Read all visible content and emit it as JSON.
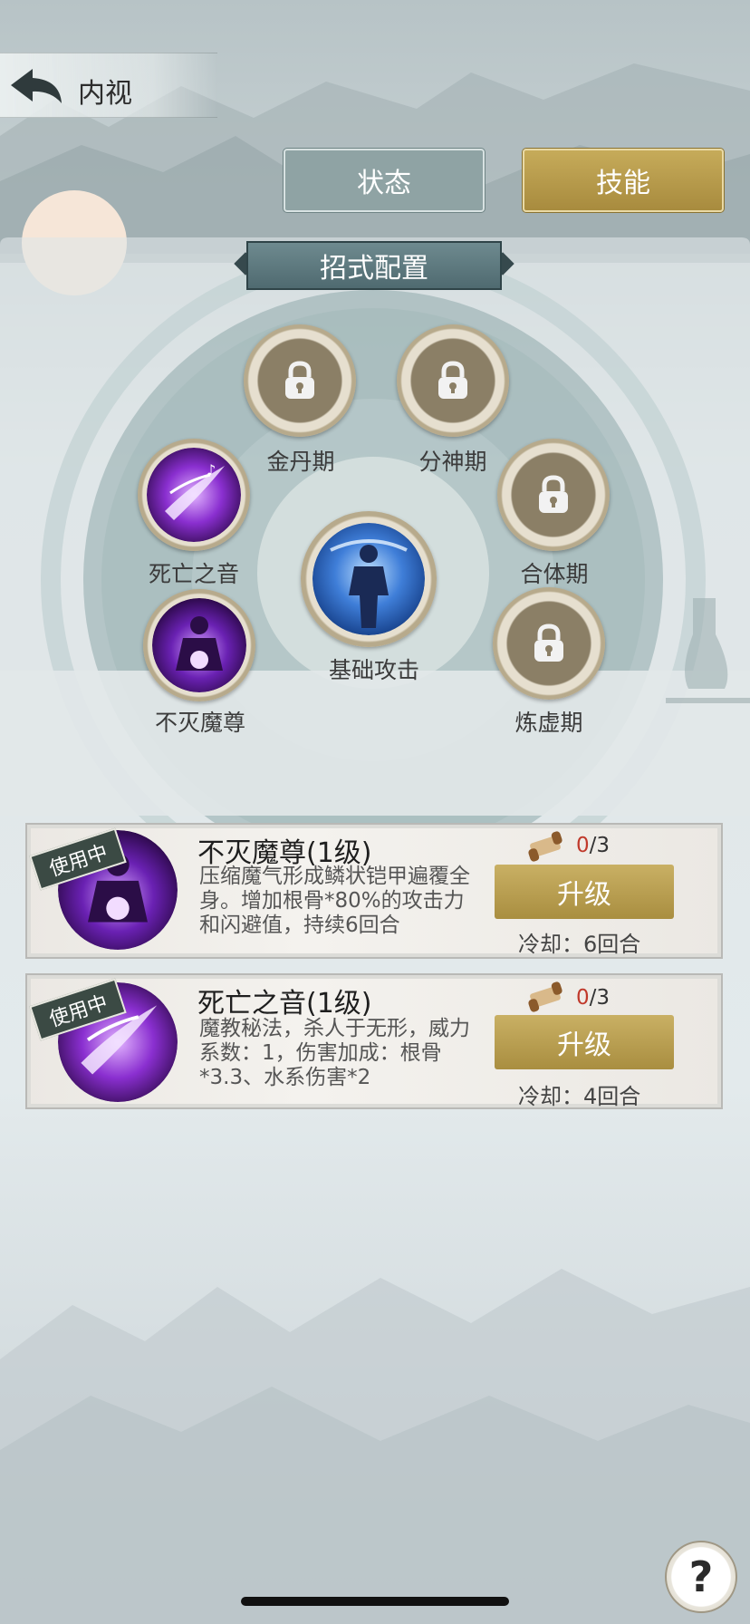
{
  "header": {
    "title": "内视",
    "back_icon": "back-arrow-icon"
  },
  "tabs": [
    {
      "label": "状态",
      "active": false
    },
    {
      "label": "技能",
      "active": true
    }
  ],
  "panel": {
    "title": "招式配置"
  },
  "slots": [
    {
      "label": "金丹期",
      "locked": true
    },
    {
      "label": "分神期",
      "locked": true
    },
    {
      "label": "死亡之音",
      "locked": false
    },
    {
      "label": "合体期",
      "locked": true
    },
    {
      "label": "基础攻击",
      "locked": false
    },
    {
      "label": "不灭魔尊",
      "locked": false
    },
    {
      "label": "炼虚期",
      "locked": true
    }
  ],
  "skills": [
    {
      "badge": "使用中",
      "name": "不灭魔尊(1级)",
      "description": "压缩魔气形成鳞状铠甲遍覆全身。增加根骨*80%的攻击力和闪避值，持续6回合",
      "count_current": "0",
      "count_total": "/3",
      "upgrade_label": "升级",
      "cooldown": "冷却：6回合"
    },
    {
      "badge": "使用中",
      "name": "死亡之音(1级)",
      "description": "魔教秘法，杀人于无形，威力系数：1，伤害加成：根骨*3.3、水系伤害*2",
      "count_current": "0",
      "count_total": "/3",
      "upgrade_label": "升级",
      "cooldown": "冷却：4回合"
    }
  ],
  "help": {
    "label": "?"
  },
  "colors": {
    "gold": "#b89a4c",
    "teal": "#5f7b80",
    "count_red": "#c0392b"
  }
}
